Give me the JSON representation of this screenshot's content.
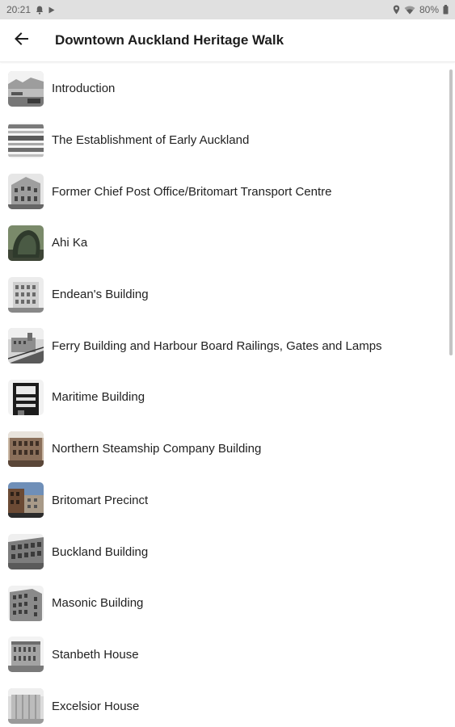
{
  "status_bar": {
    "time": "20:21",
    "battery": "80%",
    "icons": [
      "notification-bell-icon",
      "play-icon",
      "location-icon",
      "wifi-icon",
      "battery-icon"
    ]
  },
  "app_bar": {
    "title": "Downtown Auckland Heritage Walk",
    "back_icon": "arrow-back-icon"
  },
  "items": [
    {
      "label": "Introduction",
      "thumb": "harbour-photo-icon"
    },
    {
      "label": "The Establishment of Early Auckland",
      "thumb": "historic-map-icon"
    },
    {
      "label": "Former Chief Post Office/Britomart Transport Centre",
      "thumb": "post-office-photo-icon"
    },
    {
      "label": "Ahi Ka",
      "thumb": "sculpture-photo-icon"
    },
    {
      "label": "Endean's Building",
      "thumb": "building-photo-icon"
    },
    {
      "label": "Ferry Building and Harbour Board Railings, Gates and Lamps",
      "thumb": "ferry-building-photo-icon"
    },
    {
      "label": "Maritime Building",
      "thumb": "building-photo-icon"
    },
    {
      "label": "Northern Steamship Company Building",
      "thumb": "building-photo-icon"
    },
    {
      "label": "Britomart Precinct",
      "thumb": "precinct-photo-icon"
    },
    {
      "label": "Buckland Building",
      "thumb": "building-photo-icon"
    },
    {
      "label": "Masonic Building",
      "thumb": "building-photo-icon"
    },
    {
      "label": "Stanbeth House",
      "thumb": "building-photo-icon"
    },
    {
      "label": "Excelsior House",
      "thumb": "building-photo-icon"
    }
  ]
}
